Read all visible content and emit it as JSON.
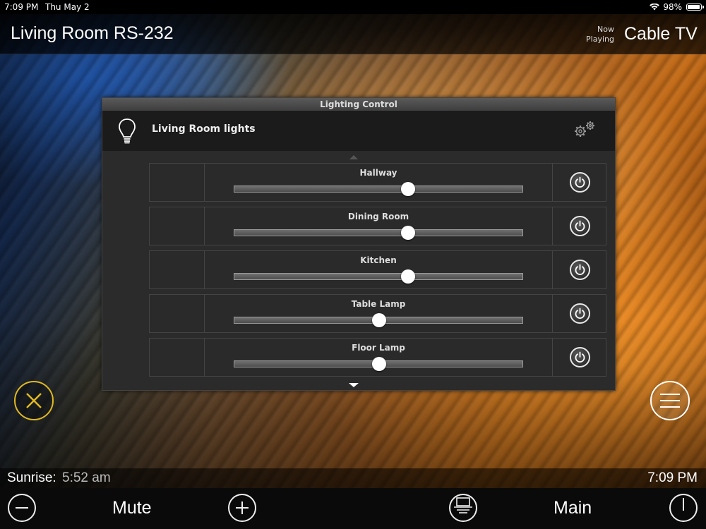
{
  "status_bar": {
    "time": "7:09 PM",
    "date": "Thu May 2",
    "battery": "98%",
    "icons": [
      "wifi-icon",
      "battery-icon"
    ]
  },
  "header": {
    "room_title": "Living Room RS-232",
    "now_playing_line1": "Now",
    "now_playing_line2": "Playing",
    "source": "Cable TV"
  },
  "dialog": {
    "title": "Lighting Control",
    "group_name": "Living Room lights",
    "icons": [
      "lightbulb-icon",
      "settings-gears-icon",
      "scroll-up-arrow-icon",
      "scroll-down-arrow-icon"
    ],
    "lights": [
      {
        "name": "Hallway",
        "level": 0.6
      },
      {
        "name": "Dining Room",
        "level": 0.6
      },
      {
        "name": "Kitchen",
        "level": 0.6
      },
      {
        "name": "Table Lamp",
        "level": 0.5
      },
      {
        "name": "Floor Lamp",
        "level": 0.5
      }
    ]
  },
  "side_buttons": {
    "close_icon": "close-x-icon",
    "menu_icon": "hamburger-menu-icon",
    "close_color": "#e0b820"
  },
  "info_bar": {
    "sunrise_label": "Sunrise:",
    "sunrise_value": "5:52 am",
    "clock": "7:09 PM"
  },
  "toolbar": {
    "volume_down_icon": "minus-icon",
    "mute_label": "Mute",
    "volume_up_icon": "plus-icon",
    "display_icon": "display-icon",
    "main_label": "Main",
    "power_icon": "power-icon"
  }
}
